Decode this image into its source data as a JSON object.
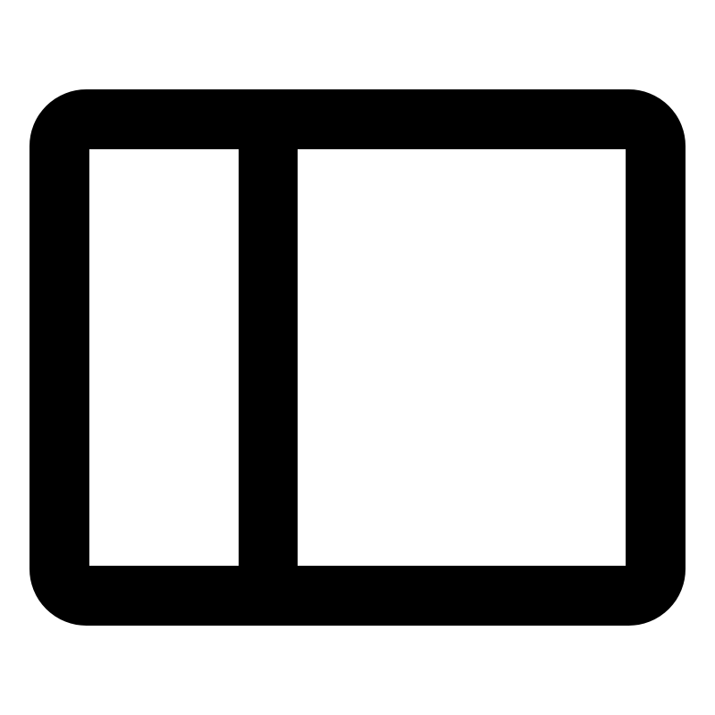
{
  "icon": {
    "name": "sidebar-layout-icon",
    "color": "#000000",
    "background": "#ffffff"
  }
}
